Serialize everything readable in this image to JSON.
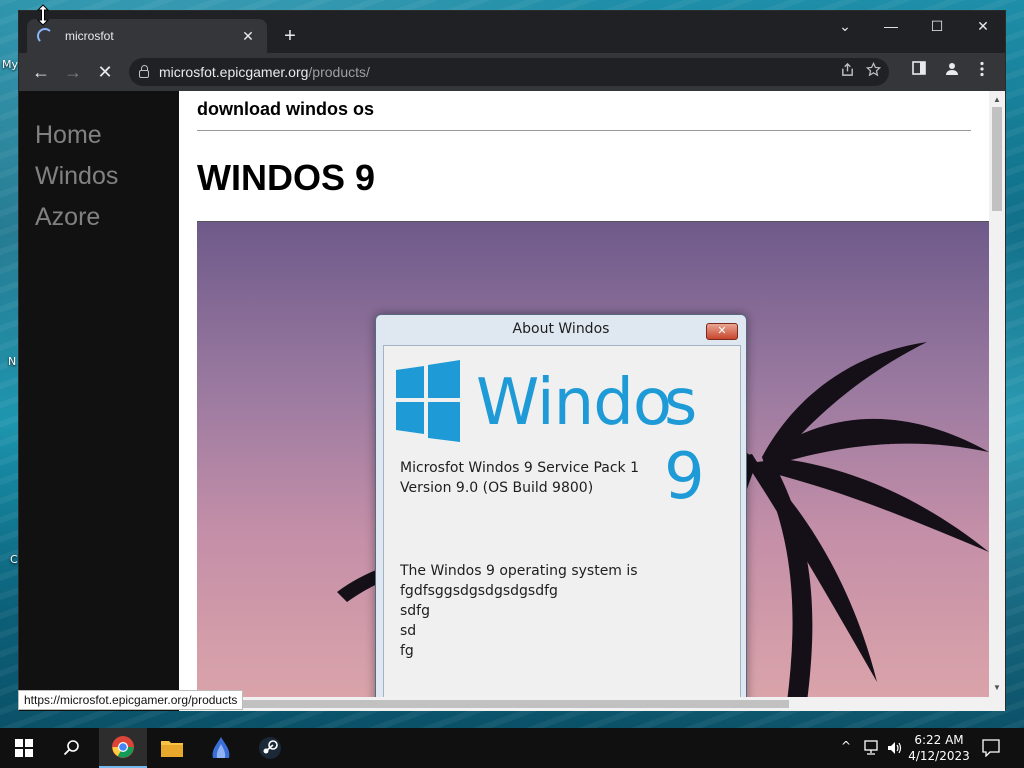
{
  "desktop": {
    "icon_labels": [
      "My",
      "N",
      "C"
    ]
  },
  "browser": {
    "tab": {
      "title": "microsfot",
      "close_label": "✕"
    },
    "new_tab_label": "+",
    "window_controls": {
      "tab_search": "⌄",
      "minimize": "—",
      "maximize": "☐",
      "close": "✕"
    },
    "nav": {
      "back": "←",
      "forward": "→",
      "stop": "✕"
    },
    "omnibox": {
      "host": "microsfot.epicgamer.org",
      "path": "/products/"
    }
  },
  "page": {
    "sidenav": [
      "Home",
      "Windos",
      "Azore"
    ],
    "header": "download windos os",
    "title": "WINDOS 9"
  },
  "dialog": {
    "title": "About Windos",
    "close_label": "✕",
    "logo": {
      "wordmark": "Windo",
      "suffix": "s 9"
    },
    "product_line": "Microsfot Windos 9 Service Pack 1",
    "version_line": "Version 9.0 (OS Build 9800)",
    "description_lines": [
      "The Windos 9 operating system is",
      "fgdfsggsdgsdgsdgsdfg",
      "sdfg",
      "sd",
      "fg"
    ]
  },
  "status_bar": {
    "url": "https://microsfot.epicgamer.org/products"
  },
  "taskbar": {
    "clock": {
      "time": "6:22 AM",
      "date": "4/12/2023"
    },
    "tray_chevron": "^"
  },
  "colors": {
    "browser_frame": "#202124",
    "browser_toolbar": "#35363a",
    "sidenav_bg": "#111111",
    "sidenav_text": "#818181",
    "windows_blue": "#1e9bd7",
    "taskbar": "#101010"
  }
}
